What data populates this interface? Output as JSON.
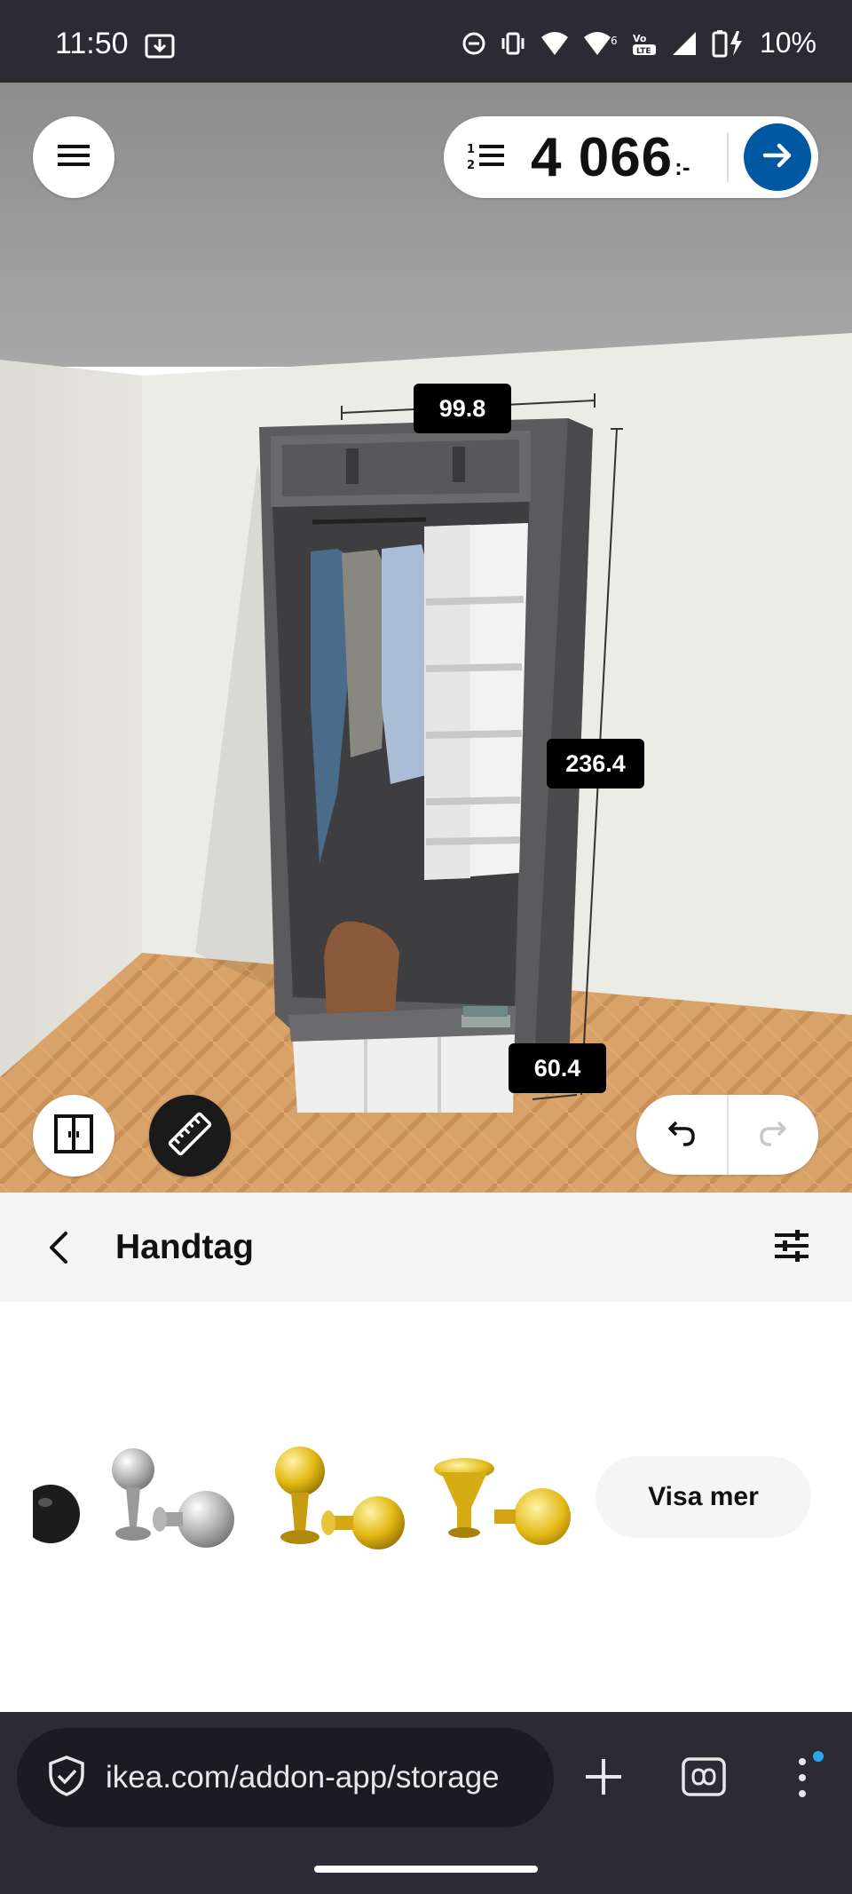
{
  "status_bar": {
    "time": "11:50",
    "battery": "10%",
    "icons": [
      "download-icon",
      "dnd-icon",
      "vibrate-icon",
      "wifi-icon",
      "wifi-6-icon",
      "volte-icon",
      "signal-icon",
      "battery-charging-icon"
    ]
  },
  "scene": {
    "price": "4 066",
    "price_suffix": ":-",
    "dimensions": {
      "width": "99.8",
      "height": "236.4",
      "depth": "60.4"
    }
  },
  "toolbar": {
    "title": "Handtag"
  },
  "products": {
    "items": [
      "black-knob",
      "steel-knob",
      "brass-round-knob",
      "brass-flat-knob"
    ],
    "more_label": "Visa mer"
  },
  "browser": {
    "url": "ikea.com/addon-app/storage"
  },
  "colors": {
    "accent": "#0058a3",
    "status_bar": "#2b2a35",
    "toolbar": "#f5f5f5",
    "badge": "#29a8f0"
  }
}
